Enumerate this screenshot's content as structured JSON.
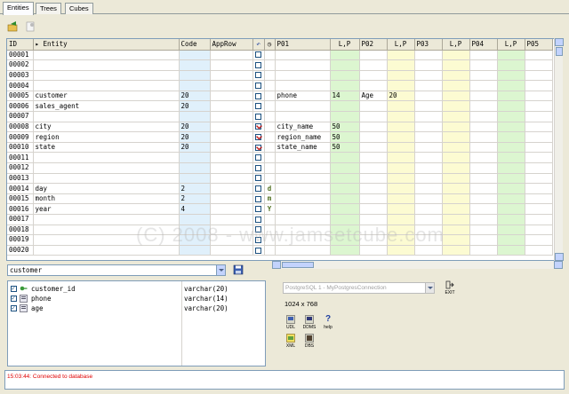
{
  "tabs": [
    "Entities",
    "Trees",
    "Cubes"
  ],
  "columns": [
    "ID",
    "Entity",
    "Code",
    "AppRow",
    "",
    "",
    "P01",
    "L,P",
    "P02",
    "L,P",
    "P03",
    "L,P",
    "P04",
    "L,P",
    "P05"
  ],
  "rows": [
    {
      "id": "00001",
      "entity": "",
      "code": "",
      "check": false,
      "sym": "",
      "p01": "",
      "lp1": "",
      "p02": "",
      "lp2": ""
    },
    {
      "id": "00002",
      "entity": "",
      "code": "",
      "check": false,
      "sym": "",
      "p01": "",
      "lp1": "",
      "p02": "",
      "lp2": ""
    },
    {
      "id": "00003",
      "entity": "",
      "code": "",
      "check": false,
      "sym": "",
      "p01": "",
      "lp1": "",
      "p02": "",
      "lp2": ""
    },
    {
      "id": "00004",
      "entity": "",
      "code": "",
      "check": false,
      "sym": "",
      "p01": "",
      "lp1": "",
      "p02": "",
      "lp2": ""
    },
    {
      "id": "00005",
      "entity": "customer",
      "code": "20",
      "check": false,
      "sym": "",
      "p01": "phone",
      "lp1": "14",
      "p02": "Age",
      "lp2": "20"
    },
    {
      "id": "00006",
      "entity": "sales_agent",
      "code": "20",
      "check": false,
      "sym": "",
      "p01": "",
      "lp1": "",
      "p02": "",
      "lp2": ""
    },
    {
      "id": "00007",
      "entity": "",
      "code": "",
      "check": false,
      "sym": "",
      "p01": "",
      "lp1": "",
      "p02": "",
      "lp2": ""
    },
    {
      "id": "00008",
      "entity": "city",
      "code": "20",
      "check": true,
      "sym": "",
      "p01": "city_name",
      "lp1": "50",
      "p02": "",
      "lp2": ""
    },
    {
      "id": "00009",
      "entity": "region",
      "code": "20",
      "check": true,
      "sym": "",
      "p01": "region_name",
      "lp1": "50",
      "p02": "",
      "lp2": ""
    },
    {
      "id": "00010",
      "entity": "state",
      "code": "20",
      "check": true,
      "sym": "",
      "p01": "state_name",
      "lp1": "50",
      "p02": "",
      "lp2": ""
    },
    {
      "id": "00011",
      "entity": "",
      "code": "",
      "check": false,
      "sym": "",
      "p01": "",
      "lp1": "",
      "p02": "",
      "lp2": ""
    },
    {
      "id": "00012",
      "entity": "",
      "code": "",
      "check": false,
      "sym": "",
      "p01": "",
      "lp1": "",
      "p02": "",
      "lp2": ""
    },
    {
      "id": "00013",
      "entity": "",
      "code": "",
      "check": false,
      "sym": "",
      "p01": "",
      "lp1": "",
      "p02": "",
      "lp2": ""
    },
    {
      "id": "00014",
      "entity": "day",
      "code": "2",
      "check": false,
      "sym": "d",
      "p01": "",
      "lp1": "",
      "p02": "",
      "lp2": ""
    },
    {
      "id": "00015",
      "entity": "month",
      "code": "2",
      "check": false,
      "sym": "m",
      "p01": "",
      "lp1": "",
      "p02": "",
      "lp2": ""
    },
    {
      "id": "00016",
      "entity": "year",
      "code": "4",
      "check": false,
      "sym": "Y",
      "p01": "",
      "lp1": "",
      "p02": "",
      "lp2": ""
    },
    {
      "id": "00017",
      "entity": "",
      "code": "",
      "check": false,
      "sym": "",
      "p01": "",
      "lp1": "",
      "p02": "",
      "lp2": ""
    },
    {
      "id": "00018",
      "entity": "",
      "code": "",
      "check": false,
      "sym": "",
      "p01": "",
      "lp1": "",
      "p02": "",
      "lp2": ""
    },
    {
      "id": "00019",
      "entity": "",
      "code": "",
      "check": false,
      "sym": "",
      "p01": "",
      "lp1": "",
      "p02": "",
      "lp2": ""
    },
    {
      "id": "00020",
      "entity": "",
      "code": "",
      "check": false,
      "sym": "",
      "p01": "",
      "lp1": "",
      "p02": "",
      "lp2": ""
    }
  ],
  "entity_select": {
    "value": "customer"
  },
  "fields": [
    {
      "name": "customer_id",
      "type": "varchar(20)",
      "icon": "key-icon"
    },
    {
      "name": "phone",
      "type": "varchar(14)",
      "icon": "field-icon"
    },
    {
      "name": "age",
      "type": "varchar(20)",
      "icon": "field-icon"
    }
  ],
  "connection": {
    "value": "PostgreSQL 1 - MyPostgresConnection",
    "exit_label": "EXIT"
  },
  "resolution": "1024 x 768",
  "tool_buttons": [
    {
      "name": "udl-button",
      "label": "UDL",
      "icon": "udl-icon"
    },
    {
      "name": "ddms-button",
      "label": "DDMS",
      "icon": "ddms-icon"
    },
    {
      "name": "help-button",
      "label": "help",
      "icon": "help-icon"
    },
    {
      "name": "xml-button",
      "label": "XML",
      "icon": "xml-icon"
    },
    {
      "name": "dbs-button",
      "label": "DBS",
      "icon": "dbs-icon"
    }
  ],
  "status": "15:03:44: Connected to database",
  "watermark": "(C) 2008 - www.jamsetcube.com",
  "colors": {
    "code_col": "#e0f0fb",
    "lp1_col": "#dcf6d0",
    "lp2_col": "#fcfbd2",
    "lp3_col": "#fcfbd2",
    "lp4_col": "#dcf6d0",
    "status_text": "#e00000"
  }
}
